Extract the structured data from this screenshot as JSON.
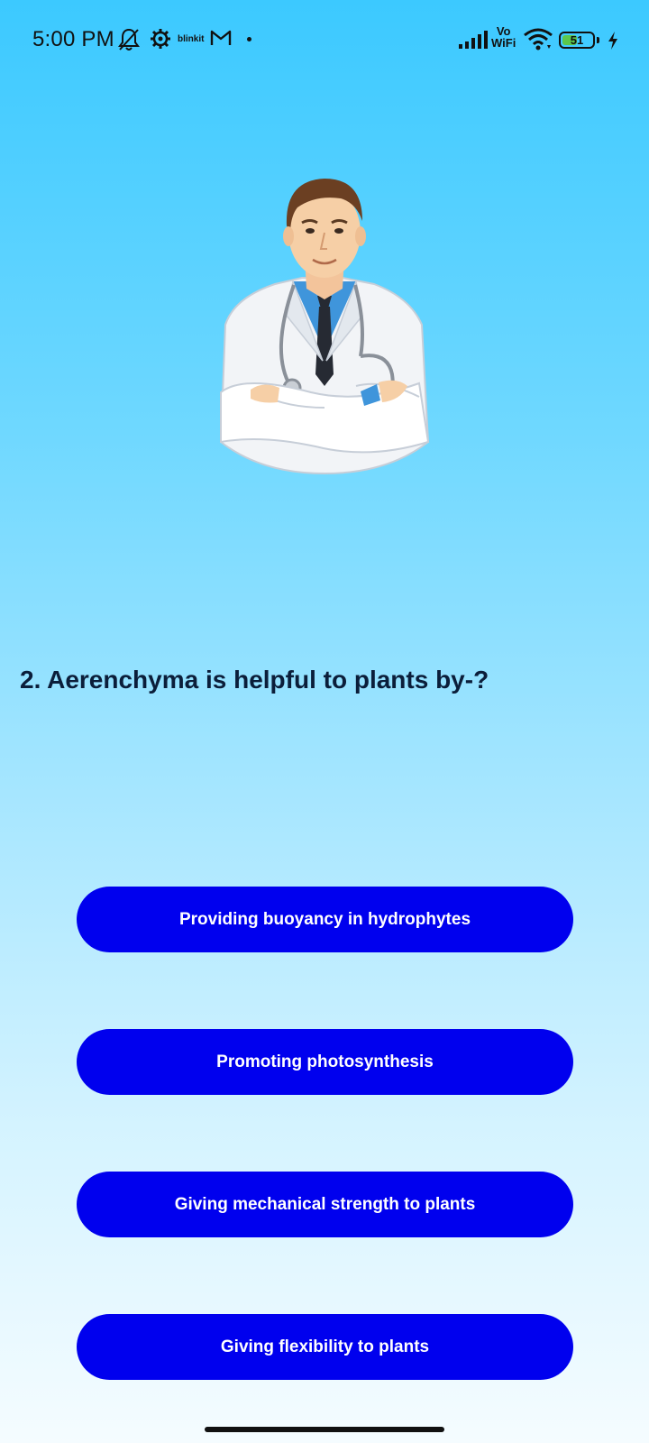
{
  "status_bar": {
    "time": "5:00 PM",
    "icons": [
      "bell-off-icon",
      "gear-icon",
      "blinkit-icon",
      "gmail-icon",
      "signal-icon",
      "vowifi-icon",
      "wifi-icon",
      "battery-icon",
      "charging-icon"
    ],
    "blinkit_label": "blinkit",
    "vowifi_top": "Vo",
    "vowifi_bottom": "WiFi",
    "battery_level": "51"
  },
  "question": {
    "text": "2. Aerenchyma is helpful to plants by-?"
  },
  "options": [
    {
      "label": "Providing buoyancy in hydrophytes"
    },
    {
      "label": "Promoting photosynthesis"
    },
    {
      "label": "Giving mechanical strength to plants"
    },
    {
      "label": "Giving flexibility to plants"
    }
  ],
  "colors": {
    "option_bg": "#0000ee",
    "option_text": "#ffffff",
    "background_top": "#3cc9ff",
    "background_bottom": "#f5fcff"
  }
}
